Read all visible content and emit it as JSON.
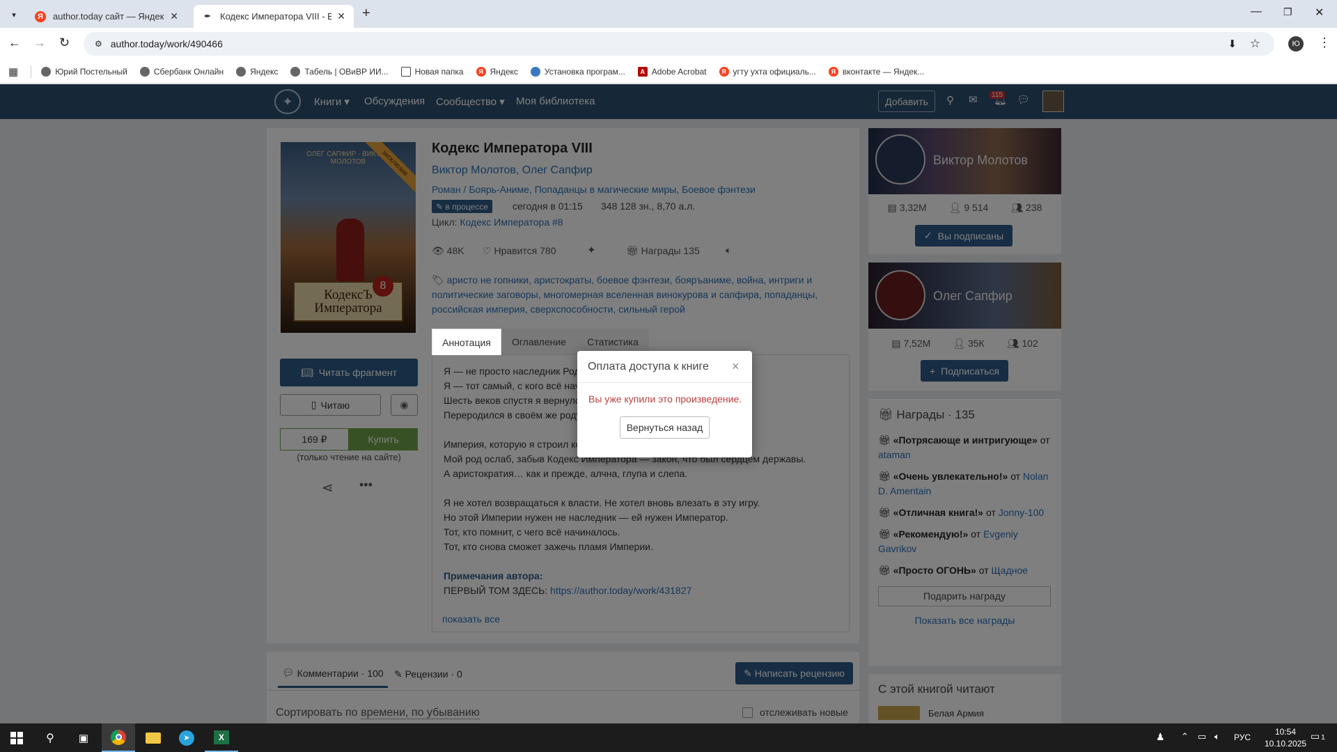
{
  "browser": {
    "tabs": [
      {
        "title": "author.today сайт — Яндекс: н"
      },
      {
        "title": "Кодекс Императора VIII - Викт"
      }
    ],
    "url": "author.today/work/490466",
    "profile_initial": "Ю",
    "bookmarks": [
      "Юрий Постельный",
      "Сбербанк Онлайн",
      "Яндекс",
      "Табель | ОВиВР ИИ...",
      "Новая папка",
      "Яндекс",
      "Установка програм...",
      "Adobe Acrobat",
      "угту ухта официаль...",
      "вконтакте — Яндек..."
    ]
  },
  "site": {
    "nav": {
      "books": "Книги",
      "discussions": "Обсуждения",
      "community": "Сообщество",
      "library": "Моя библиотека",
      "add": "Добавить",
      "notif_count": "115"
    },
    "book": {
      "title": "Кодекс Императора VIII",
      "authors": "Виктор Молотов, Олег Сапфир",
      "genres": "Роман / Боярь-Аниме, Попаданцы в магические миры, Боевое фэнтези",
      "status": "в процессе",
      "updated": "сегодня в 01:15",
      "size": "348 128 зн., 8,70 а.л.",
      "cycle_label": "Цикл:",
      "cycle": "Кодекс Императора #8",
      "views": "48K",
      "likes": "Нравится 780",
      "awards": "Награды 135",
      "tags": "аристо не гопники, аристократы, боевое фэнтези, бояръаниме, война, интриги и политические заговоры, многомерная вселенная винокурова и сапфира, попаданцы, российская империя, сверхспособности, сильный герой",
      "cover_top": "ОЛЕГ САПФИР · ВИКТОР МОЛОТОВ",
      "cover_title": "КодексЪ Императора",
      "cover_badge": "эксклюзив",
      "cover_num": "8"
    },
    "actions": {
      "read_fragment": "Читать фрагмент",
      "reading": "Читаю",
      "price": "169 ₽",
      "buy": "Купить",
      "only_site": "(только чтение на сайте)"
    },
    "tabs": [
      "Аннотация",
      "Оглавление",
      "Статистика"
    ],
    "annotation": {
      "p1": [
        "Я — не просто наследник Рода. Я — Император.",
        "Я — тот самый, с кого всё началось, с кого история стала плотью.",
        "Шесть веков спустя я вернулся.",
        "Переродился в своём же роду, чтобы вернуть себе моё наследие."
      ],
      "p2": [
        "Империя, которую я строил когда-то, погрязла в хаосе и раздором.",
        "Мой род ослаб, забыв Кодекс Императора — закон, что был сердцем державы.",
        "А аристократия… как и прежде, алчна, глупа и слепа."
      ],
      "p3": [
        "Я не хотел возвращаться к власти. Не хотел вновь влезать в эту игру.",
        "Но этой Империи нужен не наследник — ей нужен Император.",
        "Тот, кто помнит, с чего всё начиналось.",
        "Тот, кто снова сможет зажечь пламя Империи."
      ],
      "notes_label": "Примечания автора:",
      "notes_text": "ПЕРВЫЙ ТОМ ЗДЕСЬ: ",
      "notes_link": "https://author.today/work/431827",
      "show_all": "показать все"
    },
    "authors_cards": [
      {
        "name": "Виктор Молотов",
        "books": "3,32М",
        "followers": "9 514",
        "friends": "238",
        "button": "Вы подписаны"
      },
      {
        "name": "Олег Сапфир",
        "books": "7,52М",
        "followers": "35К",
        "friends": "102",
        "button": "Подписаться"
      }
    ],
    "awards": {
      "title": "Награды",
      "count": "135",
      "from": "от",
      "items": [
        {
          "name": "«Потрясающе и интригующе»",
          "user": "ataman"
        },
        {
          "name": "«Очень увлекательно!»",
          "user": "Nolan D. Amentain"
        },
        {
          "name": "«Отличная книга!»",
          "user": "Jonny-100"
        },
        {
          "name": "«Рекомендую!»",
          "user": "Evgeniy Gavrikov"
        },
        {
          "name": "«Просто ОГОНЬ»",
          "user": "Щадное"
        }
      ],
      "gift": "Подарить награду",
      "show_all": "Показать все награды"
    },
    "also_reading": {
      "title": "С этой книгой читают",
      "item": "Белая Армия"
    },
    "comments": {
      "label": "Комментарии",
      "count": "100",
      "reviews": "Рецензии",
      "reviews_count": "0",
      "write_review": "Написать рецензию",
      "sort_prefix": "Сортировать по",
      "sort_value": "времени, по убыванию",
      "track": "отслеживать новые"
    }
  },
  "modal": {
    "title": "Оплата доступа к книге",
    "message": "Вы уже купили это произведение.",
    "back": "Вернуться назад"
  },
  "taskbar": {
    "lang": "РУС",
    "time": "10:54",
    "date": "10.10.2025",
    "notif": "1"
  }
}
